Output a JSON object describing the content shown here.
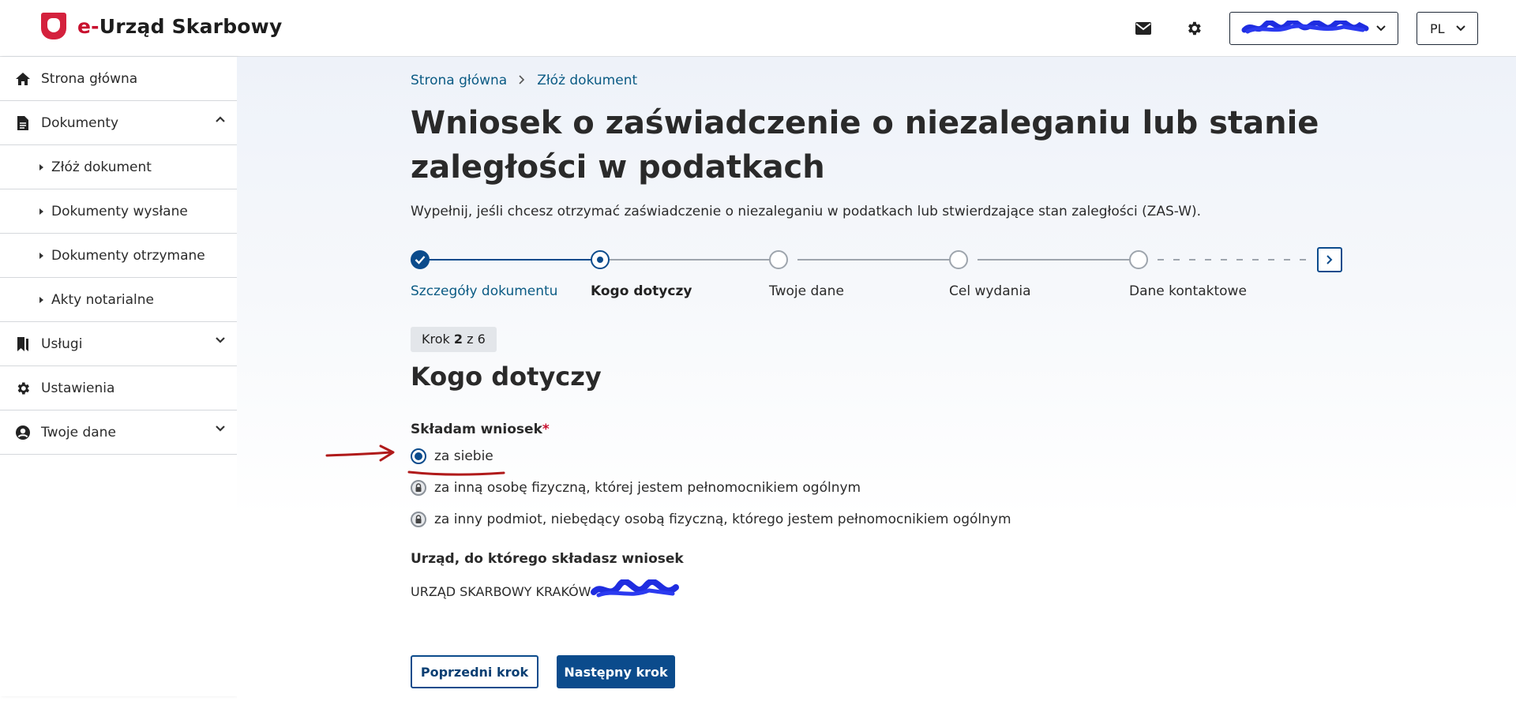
{
  "header": {
    "logo_prefix": "e-",
    "logo_text": "Urząd Skarbowy",
    "lang": "PL"
  },
  "sidebar": {
    "items": [
      {
        "label": "Strona główna",
        "icon": "home-icon"
      },
      {
        "label": "Dokumenty",
        "icon": "document-icon",
        "expanded": true
      },
      {
        "label": "Złóż dokument",
        "sub": true
      },
      {
        "label": "Dokumenty wysłane",
        "sub": true
      },
      {
        "label": "Dokumenty otrzymane",
        "sub": true
      },
      {
        "label": "Akty notarialne",
        "sub": true
      },
      {
        "label": "Usługi",
        "icon": "bookmark-icon",
        "expanded": false
      },
      {
        "label": "Ustawienia",
        "icon": "gear-icon"
      },
      {
        "label": "Twoje dane",
        "icon": "user-icon",
        "expanded": false
      }
    ]
  },
  "breadcrumb": [
    "Strona główna",
    "Złóż dokument"
  ],
  "page": {
    "title": "Wniosek o zaświadczenie o niezaleganiu lub stanie zaległości w podatkach",
    "lead": "Wypełnij, jeśli chcesz otrzymać zaświadczenie o niezaleganiu w podatkach lub stwierdzające stan zaległości (ZAS-W)."
  },
  "stepper": {
    "steps": [
      {
        "label": "Szczegóły dokumentu",
        "state": "done"
      },
      {
        "label": "Kogo dotyczy",
        "state": "current"
      },
      {
        "label": "Twoje dane",
        "state": "todo"
      },
      {
        "label": "Cel wydania",
        "state": "todo"
      },
      {
        "label": "Dane kontaktowe",
        "state": "todo"
      }
    ],
    "counter_prefix": "Krok",
    "counter_current": "2",
    "counter_sep": "z",
    "counter_total": "6"
  },
  "section": {
    "title": "Kogo dotyczy",
    "field_label": "Składam wniosek",
    "required_mark": "*",
    "options": [
      {
        "label": "za siebie",
        "state": "checked"
      },
      {
        "label": "za inną osobę fizyczną, której jestem pełnomocnikiem ogólnym",
        "state": "locked"
      },
      {
        "label": "za inny podmiot, niebędący osobą fizyczną, którego jestem pełnomocnikiem ogólnym",
        "state": "locked"
      }
    ],
    "office_label": "Urząd, do którego składasz wniosek",
    "office_value": "URZĄD SKARBOWY KRAKÓW"
  },
  "buttons": {
    "prev": "Poprzedni krok",
    "next": "Następny krok"
  },
  "colors": {
    "primary": "#0b4b8c",
    "brand_red": "#c8102e",
    "annotation_red": "#b01a1a",
    "redaction_blue": "#1f2de0"
  }
}
